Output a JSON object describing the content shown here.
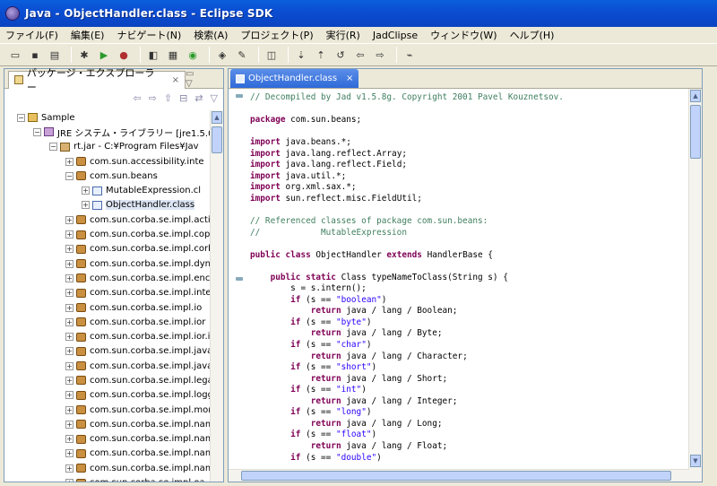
{
  "window": {
    "title": "Java - ObjectHandler.class - Eclipse SDK"
  },
  "menu": [
    "ファイル(F)",
    "編集(E)",
    "ナビゲート(N)",
    "検索(A)",
    "プロジェクト(P)",
    "実行(R)",
    "JadClipse",
    "ウィンドウ(W)",
    "ヘルプ(H)"
  ],
  "explorer": {
    "tab_label": "パッケージ・エクスプローラー",
    "tree": [
      {
        "label": "Sample",
        "level": 0,
        "toggle": "-",
        "icon": "project-icon"
      },
      {
        "label": "JRE システム・ライブラリー [jre1.5.0_",
        "level": 1,
        "toggle": "-",
        "icon": "library-icon"
      },
      {
        "label": "rt.jar - C:¥Program Files¥Jav",
        "level": 2,
        "toggle": "-",
        "icon": "jar-icon"
      },
      {
        "label": "com.sun.accessibility.inte",
        "level": 3,
        "toggle": "+",
        "icon": "package-icon"
      },
      {
        "label": "com.sun.beans",
        "level": 3,
        "toggle": "-",
        "icon": "package-icon"
      },
      {
        "label": "MutableExpression.cl",
        "level": 4,
        "toggle": "+",
        "icon": "class-icon"
      },
      {
        "label": "ObjectHandler.class",
        "level": 4,
        "toggle": "+",
        "icon": "class-icon",
        "selected": true
      },
      {
        "label": "com.sun.corba.se.impl.acti",
        "level": 3,
        "toggle": "+",
        "icon": "package-icon"
      },
      {
        "label": "com.sun.corba.se.impl.cop",
        "level": 3,
        "toggle": "+",
        "icon": "package-icon"
      },
      {
        "label": "com.sun.corba.se.impl.corb",
        "level": 3,
        "toggle": "+",
        "icon": "package-icon"
      },
      {
        "label": "com.sun.corba.se.impl.dyn",
        "level": 3,
        "toggle": "+",
        "icon": "package-icon"
      },
      {
        "label": "com.sun.corba.se.impl.enc",
        "level": 3,
        "toggle": "+",
        "icon": "package-icon"
      },
      {
        "label": "com.sun.corba.se.impl.inte",
        "level": 3,
        "toggle": "+",
        "icon": "package-icon"
      },
      {
        "label": "com.sun.corba.se.impl.io",
        "level": 3,
        "toggle": "+",
        "icon": "package-icon"
      },
      {
        "label": "com.sun.corba.se.impl.ior",
        "level": 3,
        "toggle": "+",
        "icon": "package-icon"
      },
      {
        "label": "com.sun.corba.se.impl.ior.i",
        "level": 3,
        "toggle": "+",
        "icon": "package-icon"
      },
      {
        "label": "com.sun.corba.se.impl.java",
        "level": 3,
        "toggle": "+",
        "icon": "package-icon"
      },
      {
        "label": "com.sun.corba.se.impl.java",
        "level": 3,
        "toggle": "+",
        "icon": "package-icon"
      },
      {
        "label": "com.sun.corba.se.impl.lega",
        "level": 3,
        "toggle": "+",
        "icon": "package-icon"
      },
      {
        "label": "com.sun.corba.se.impl.logg",
        "level": 3,
        "toggle": "+",
        "icon": "package-icon"
      },
      {
        "label": "com.sun.corba.se.impl.mon",
        "level": 3,
        "toggle": "+",
        "icon": "package-icon"
      },
      {
        "label": "com.sun.corba.se.impl.nam",
        "level": 3,
        "toggle": "+",
        "icon": "package-icon"
      },
      {
        "label": "com.sun.corba.se.impl.nam",
        "level": 3,
        "toggle": "+",
        "icon": "package-icon"
      },
      {
        "label": "com.sun.corba.se.impl.nam",
        "level": 3,
        "toggle": "+",
        "icon": "package-icon"
      },
      {
        "label": "com.sun.corba.se.impl.nam",
        "level": 3,
        "toggle": "+",
        "icon": "package-icon"
      },
      {
        "label": "com.sun.corba.se.impl.oa",
        "level": 3,
        "toggle": "+",
        "icon": "package-icon"
      }
    ]
  },
  "editor": {
    "tab_label": "ObjectHandler.class",
    "code_lines": [
      [
        {
          "t": "// Decompiled by Jad v1.5.8g. Copyright 2001 Pavel Kouznetsov.",
          "c": "cm"
        }
      ],
      [
        {
          "t": "",
          "c": ""
        }
      ],
      [
        {
          "t": "package",
          "c": "kw"
        },
        {
          "t": " com.sun.beans;",
          "c": ""
        }
      ],
      [
        {
          "t": "",
          "c": ""
        }
      ],
      [
        {
          "t": "import",
          "c": "kw"
        },
        {
          "t": " java.beans.*;",
          "c": ""
        }
      ],
      [
        {
          "t": "import",
          "c": "kw"
        },
        {
          "t": " java.lang.reflect.Array;",
          "c": ""
        }
      ],
      [
        {
          "t": "import",
          "c": "kw"
        },
        {
          "t": " java.lang.reflect.Field;",
          "c": ""
        }
      ],
      [
        {
          "t": "import",
          "c": "kw"
        },
        {
          "t": " java.util.*;",
          "c": ""
        }
      ],
      [
        {
          "t": "import",
          "c": "kw"
        },
        {
          "t": " org.xml.sax.*;",
          "c": ""
        }
      ],
      [
        {
          "t": "import",
          "c": "kw"
        },
        {
          "t": " sun.reflect.misc.FieldUtil;",
          "c": ""
        }
      ],
      [
        {
          "t": "",
          "c": ""
        }
      ],
      [
        {
          "t": "// Referenced classes of package com.sun.beans:",
          "c": "cm"
        }
      ],
      [
        {
          "t": "//            MutableExpression",
          "c": "cm"
        }
      ],
      [
        {
          "t": "",
          "c": ""
        }
      ],
      [
        {
          "t": "public class",
          "c": "kw"
        },
        {
          "t": " ObjectHandler ",
          "c": ""
        },
        {
          "t": "extends",
          "c": "kw"
        },
        {
          "t": " HandlerBase {",
          "c": ""
        }
      ],
      [
        {
          "t": "",
          "c": ""
        }
      ],
      [
        {
          "t": "    ",
          "c": ""
        },
        {
          "t": "public static",
          "c": "kw"
        },
        {
          "t": " Class typeNameToClass(String s) {",
          "c": ""
        }
      ],
      [
        {
          "t": "        s = s.intern();",
          "c": ""
        }
      ],
      [
        {
          "t": "        ",
          "c": ""
        },
        {
          "t": "if",
          "c": "kw"
        },
        {
          "t": " (s == ",
          "c": ""
        },
        {
          "t": "\"boolean\"",
          "c": "str"
        },
        {
          "t": ")",
          "c": ""
        }
      ],
      [
        {
          "t": "            ",
          "c": ""
        },
        {
          "t": "return",
          "c": "kw"
        },
        {
          "t": " java / lang / Boolean;",
          "c": ""
        }
      ],
      [
        {
          "t": "        ",
          "c": ""
        },
        {
          "t": "if",
          "c": "kw"
        },
        {
          "t": " (s == ",
          "c": ""
        },
        {
          "t": "\"byte\"",
          "c": "str"
        },
        {
          "t": ")",
          "c": ""
        }
      ],
      [
        {
          "t": "            ",
          "c": ""
        },
        {
          "t": "return",
          "c": "kw"
        },
        {
          "t": " java / lang / Byte;",
          "c": ""
        }
      ],
      [
        {
          "t": "        ",
          "c": ""
        },
        {
          "t": "if",
          "c": "kw"
        },
        {
          "t": " (s == ",
          "c": ""
        },
        {
          "t": "\"char\"",
          "c": "str"
        },
        {
          "t": ")",
          "c": ""
        }
      ],
      [
        {
          "t": "            ",
          "c": ""
        },
        {
          "t": "return",
          "c": "kw"
        },
        {
          "t": " java / lang / Character;",
          "c": ""
        }
      ],
      [
        {
          "t": "        ",
          "c": ""
        },
        {
          "t": "if",
          "c": "kw"
        },
        {
          "t": " (s == ",
          "c": ""
        },
        {
          "t": "\"short\"",
          "c": "str"
        },
        {
          "t": ")",
          "c": ""
        }
      ],
      [
        {
          "t": "            ",
          "c": ""
        },
        {
          "t": "return",
          "c": "kw"
        },
        {
          "t": " java / lang / Short;",
          "c": ""
        }
      ],
      [
        {
          "t": "        ",
          "c": ""
        },
        {
          "t": "if",
          "c": "kw"
        },
        {
          "t": " (s == ",
          "c": ""
        },
        {
          "t": "\"int\"",
          "c": "str"
        },
        {
          "t": ")",
          "c": ""
        }
      ],
      [
        {
          "t": "            ",
          "c": ""
        },
        {
          "t": "return",
          "c": "kw"
        },
        {
          "t": " java / lang / Integer;",
          "c": ""
        }
      ],
      [
        {
          "t": "        ",
          "c": ""
        },
        {
          "t": "if",
          "c": "kw"
        },
        {
          "t": " (s == ",
          "c": ""
        },
        {
          "t": "\"long\"",
          "c": "str"
        },
        {
          "t": ")",
          "c": ""
        }
      ],
      [
        {
          "t": "            ",
          "c": ""
        },
        {
          "t": "return",
          "c": "kw"
        },
        {
          "t": " java / lang / Long;",
          "c": ""
        }
      ],
      [
        {
          "t": "        ",
          "c": ""
        },
        {
          "t": "if",
          "c": "kw"
        },
        {
          "t": " (s == ",
          "c": ""
        },
        {
          "t": "\"float\"",
          "c": "str"
        },
        {
          "t": ")",
          "c": ""
        }
      ],
      [
        {
          "t": "            ",
          "c": ""
        },
        {
          "t": "return",
          "c": "kw"
        },
        {
          "t": " java / lang / Float;",
          "c": ""
        }
      ],
      [
        {
          "t": "        ",
          "c": ""
        },
        {
          "t": "if",
          "c": "kw"
        },
        {
          "t": " (s == ",
          "c": ""
        },
        {
          "t": "\"double\"",
          "c": "str"
        },
        {
          "t": ")",
          "c": ""
        }
      ]
    ]
  },
  "colors": {
    "keyword": "#7f0055",
    "string": "#2a00ff",
    "comment": "#3f7f5f",
    "titlebar": "#0b4ed3",
    "chrome": "#ece9d8"
  }
}
